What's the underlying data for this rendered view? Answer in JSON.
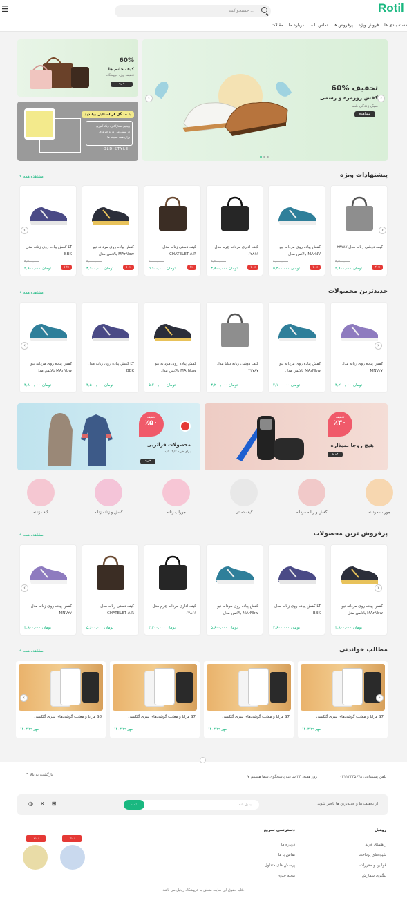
{
  "header": {
    "logo": "Rotil",
    "search_placeholder": "جستجو کنید ...",
    "nav": [
      "دسته بندی ها",
      "فروش ویژه",
      "پرفروش ها",
      "تماس با ما",
      "درباره ما",
      "مقالات"
    ]
  },
  "hero": {
    "main_title": "60% تخفیف",
    "main_sub": "کفش روزمره و رسمی",
    "main_sub2": "سبک زندگی شما",
    "main_btn": "مشاهده",
    "bags_pct": "60%",
    "bags_title": "کیف خانم ها",
    "bags_sub": "تخفیف ویژه فروشگاه",
    "bags_btn": "خرید",
    "style_title": "با ما گل از استایل بیاندید",
    "style_lines": [
      "زیبایی ستارگانی، رنگ آمیزی",
      "در سبک مد روز و امروزی",
      "برای همه سلیقه ها"
    ],
    "style_tag": "OLD STYLE"
  },
  "sec1": {
    "title": "پیشنهادات ویژه",
    "more": "مشاهده همه",
    "items": [
      {
        "name": "کیف دوشی زنانه مدل ۲۴۷۸۷",
        "old": "۳,۵۰۰,۰۰۰",
        "price": "۲,۸۰۰,۰۰۰ تومان",
        "off": "۲۰٪",
        "kind": "bag-grey"
      },
      {
        "name": "کفش پیاده روی مردانه نیو بالانس مدل MArNV",
        "old": "۶,۰۰۰,۰۰۰",
        "price": "۵,۴۰۰,۰۰۰ تومان",
        "off": "۱۰٪",
        "kind": "shoe-teal"
      },
      {
        "name": "کیف اداری مردانه چرم مدل ۶۲۸۶۶",
        "old": "۴,۲۰۰,۰۰۰",
        "price": "۳,۸۰۰,۰۰۰ تومان",
        "off": "۱۰٪",
        "kind": "bag-black"
      },
      {
        "name": "کیف دستی زنانه مدل CHATELET AIR",
        "old": "۶,۰۰۰,۰۰۰",
        "price": "۵,۶۰۰,۰۰۰ تومان",
        "off": "۷٪",
        "kind": "bag-brown"
      },
      {
        "name": "کفش پیاده روی مردانه نیو بالانس مدل MArNbw",
        "old": "۴,۰۰۰,۰۰۰",
        "price": "۳,۶۰۰,۰۰۰ تومان",
        "off": "۱۰٪",
        "kind": "shoe-dark"
      },
      {
        "name": "کفش پیاده روی زنانه مدل LT BBK",
        "old": "۳,۵۰۰,۰۰۰",
        "price": "۲,۹۰۰,۰۰۰ تومان",
        "off": "۱۷٪",
        "kind": "shoe-purple"
      }
    ]
  },
  "sec2": {
    "title": "جدیدترین محصولات",
    "more": "مشاهده همه",
    "items": [
      {
        "name": "کفش پیاده روی زنانه مدل MNV۲۷",
        "price": "۴,۲۰۰,۰۰۰ تومان",
        "kind": "shoe-lilac"
      },
      {
        "name": "کفش پیاده روی مردانه نیو بالانس مدل MArNbw",
        "price": "۴,۱۰۰,۰۰۰ تومان",
        "kind": "shoe-teal"
      },
      {
        "name": "کیف دوشی زنانه دیانا مدل ۲۴۷۸۷",
        "price": "۳,۲۰۰,۰۰۰ تومان",
        "kind": "bag-grey"
      },
      {
        "name": "کفش پیاده روی مردانه نیو بالانس مدل MArNbw",
        "price": "۵,۲۰۰,۰۰۰ تومان",
        "kind": "shoe-dark"
      },
      {
        "name": "کفش پیاده روی زنانه مدل LT BBK",
        "price": "۴,۵۰۰,۰۰۰ تومان",
        "kind": "shoe-purple"
      },
      {
        "name": "کفش پیاده روی مردانه نیو بالانس مدل MArNbw",
        "price": "۴,۸۰۰,۰۰۰ تومان",
        "kind": "shoe-teal"
      }
    ]
  },
  "promo": {
    "left_pct": "٪۳۰",
    "left_lbl": "تخفیف",
    "left_title": "هیچ روجا نمیذاره",
    "left_btn": "خرید",
    "right_pct": "٪۵۰",
    "right_lbl": "تخفیف",
    "right_title": "محصولات فراتریی",
    "right_sub": "برای خرید کلیک کنید",
    "right_btn": "خرید"
  },
  "cats": [
    {
      "name": "جوراب مردانه",
      "c": "#f7d7b0"
    },
    {
      "name": "کفش و زنانه مردانه",
      "c": "#f1c9c9"
    },
    {
      "name": "کیف دستی",
      "c": "#e8e8e8"
    },
    {
      "name": "جوراب زنانه",
      "c": "#f7c6d5"
    },
    {
      "name": "کفش و زنانه زنانه",
      "c": "#f4c4d8"
    },
    {
      "name": "کیف زنانه",
      "c": "#f5c7d2"
    }
  ],
  "sec3": {
    "title": "پرفروش ترین محصولات",
    "more": "مشاهده همه",
    "items": [
      {
        "name": "کفش پیاده روی مردانه نیو بالانس مدل MArNbw",
        "price": "۴,۸۰۰,۰۰۰ تومان",
        "kind": "shoe-dark"
      },
      {
        "name": "کفش پیاده روی زنانه مدل LT BBK",
        "price": "۳,۶۰۰,۰۰۰ تومان",
        "kind": "shoe-purple"
      },
      {
        "name": "کفش پیاده روی مردانه نیو بالانس مدل MArNbw",
        "price": "۵,۶۰۰,۰۰۰ تومان",
        "kind": "shoe-teal"
      },
      {
        "name": "کیف اداری مردانه چرم مدل ۶۲۸۶۶",
        "price": "۴,۲۰۰,۰۰۰ تومان",
        "kind": "bag-black"
      },
      {
        "name": "کیف دستی زنانه مدل CHATELET AIR",
        "price": "۵,۶۰۰,۰۰۰ تومان",
        "kind": "bag-brown"
      },
      {
        "name": "کفش پیاده روی زنانه مدل MNV۲۷",
        "price": "۳,۹۰۰,۰۰۰ تومان",
        "kind": "shoe-lilac"
      }
    ]
  },
  "sec4": {
    "title": "مطالب خواندنی",
    "more": "مشاهده همه",
    "items": [
      {
        "title": "مزایا و معایب گوشی‌های سری گلکسی S7",
        "date": "۱۴۰۳ مهر ۲۹"
      },
      {
        "title": "مزایا و معایب گوشی‌های سری گلکسی S7",
        "date": "۱۴۰۳ مهر ۲۹"
      },
      {
        "title": "مزایا و معایب گوشی‌های سری گلکسی S7",
        "date": "۱۴۰۳ مهر ۲۹"
      },
      {
        "title": "مزایا و معایب گوشی‌های سری گلکسی S8",
        "date": "۱۴۰۳ مهر ۲۹"
      }
    ]
  },
  "footer": {
    "phone": "تلفن پشتیبانی: ۰۲۱۱۲۳۴۵۶۷۸",
    "hours": "۷ روز هفته، ۲۴ ساعته پاسخگوی شما هستیم",
    "backtop": "بازگشت به بالا",
    "newsletter": "از تخفیف ها و جدیدترین ها باخبر شوید",
    "email_ph": "ایمیل شما",
    "subscribe": "ثبت",
    "col1_title": "روتیل",
    "col1": [
      "راهنمای خرید",
      "شیوه‌های پرداخت",
      "قوانین و مقررات",
      "پیگیری سفارش"
    ],
    "col2_title": "دسترسی سریع",
    "col2": [
      "درباره ما",
      "تماس با ما",
      "پرسش های متداول",
      "مجله خبری"
    ],
    "badge": "نماد",
    "copyright": "کلیه حقوق این سایت متعلق به فروشگاه روتیل می باشد."
  },
  "colors": {
    "accent": "#19b880",
    "danger": "#e53935"
  }
}
